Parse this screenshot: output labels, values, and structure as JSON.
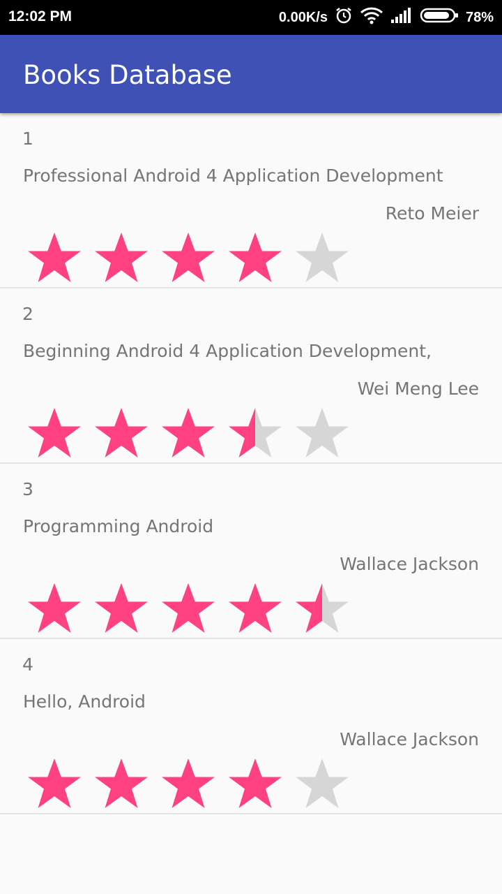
{
  "status_bar": {
    "time": "12:02 PM",
    "net_speed": "0.00K/s",
    "battery": "78%",
    "icons": [
      "alarm-icon",
      "wifi-icon",
      "signal-icon",
      "battery-icon"
    ]
  },
  "app_bar": {
    "title": "Books Database",
    "color": "#3f51b5"
  },
  "colors": {
    "star_filled": "#ff4081",
    "star_empty": "#d6d6d6"
  },
  "books": [
    {
      "id": "1",
      "title": "Professional Android 4 Application Development",
      "author": "Reto Meier",
      "rating": 4.0
    },
    {
      "id": "2",
      "title": "Beginning Android 4 Application Development,",
      "author": "Wei Meng Lee",
      "rating": 3.5
    },
    {
      "id": "3",
      "title": "Programming Android",
      "author": "Wallace Jackson",
      "rating": 4.5
    },
    {
      "id": "4",
      "title": "Hello, Android",
      "author": "Wallace Jackson",
      "rating": 4.0
    }
  ],
  "max_rating": 5
}
